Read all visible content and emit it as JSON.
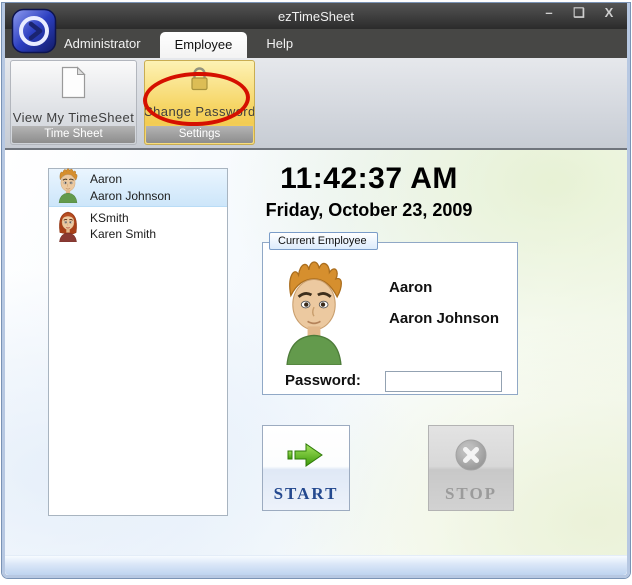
{
  "window": {
    "title": "ezTimeSheet",
    "minimize_glyph": "–",
    "maximize_glyph": "❑",
    "close_glyph": "X"
  },
  "tabs": [
    {
      "label": "Administrator",
      "active": false
    },
    {
      "label": "Employee",
      "active": true
    },
    {
      "label": "Help",
      "active": false
    }
  ],
  "toolbar": {
    "groups": [
      {
        "button_label": "View My TimeSheet",
        "icon": "document-icon",
        "caption": "Time Sheet",
        "highlighted": false
      },
      {
        "button_label": "Change Password",
        "icon": "lock-icon",
        "caption": "Settings",
        "highlighted": true,
        "annotation": "red-ellipse"
      }
    ]
  },
  "clock": {
    "time": "11:42:37 AM",
    "date": "Friday, October 23, 2009"
  },
  "employee_list": [
    {
      "username": "Aaron",
      "full_name": "Aaron Johnson",
      "selected": true,
      "avatar": "male-avatar"
    },
    {
      "username": "KSmith",
      "full_name": "Karen Smith",
      "selected": false,
      "avatar": "female-avatar"
    }
  ],
  "current_employee": {
    "group_label": "Current Employee",
    "username": "Aaron",
    "full_name": "Aaron Johnson",
    "password_label": "Password:",
    "password_value": ""
  },
  "actions": {
    "start_label": "START",
    "stop_label": "STOP",
    "stop_disabled": true
  },
  "colors": {
    "highlight_yellow": "#f6d565",
    "annotation_red": "#d51000",
    "start_text_blue": "#24498f",
    "selected_row_blue": "#cde6fa",
    "titlebar_dark": "#2b2b2b"
  }
}
